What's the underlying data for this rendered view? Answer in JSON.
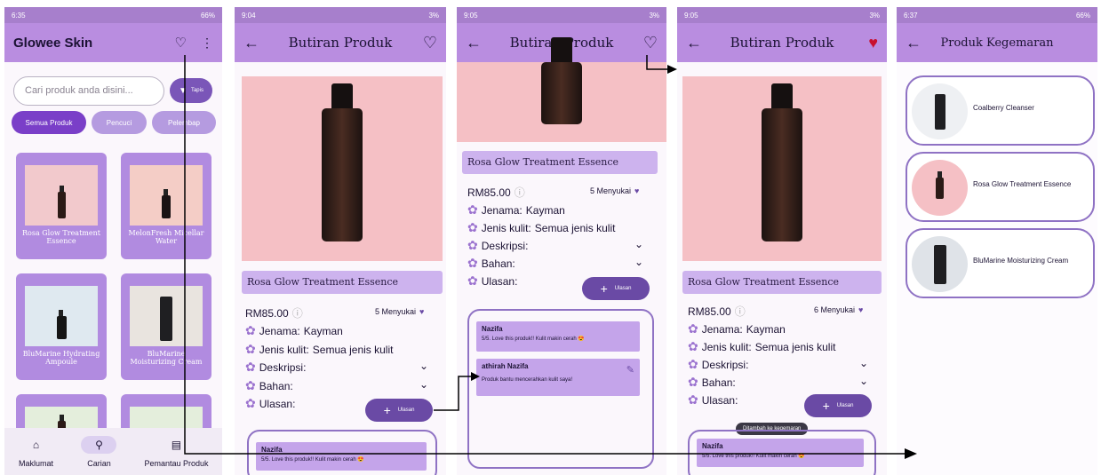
{
  "screen1": {
    "status_time": "6:35",
    "status_right": "66%",
    "brand": "Glowee Skin",
    "search_placeholder": "Cari produk anda disini...",
    "filter_label": "Tapis",
    "chips": [
      "Semua Produk",
      "Pencuci",
      "Pelembap"
    ],
    "products": [
      "Rosa Glow Treatment Essence",
      "MelonFresh Micellar Water",
      "BluMarine Hydrating Ampoule",
      "BluMarine Moisturizing Cream"
    ],
    "nav": [
      "Maklumat",
      "Carian",
      "Pemantau Produk"
    ]
  },
  "detail": {
    "header": "Butiran Produk",
    "product_name": "Rosa Glow Treatment Essence",
    "price": "RM85.00",
    "likes_a": "5 Menyukai",
    "likes_b": "6 Menyukai",
    "brand_label": "Jenama:",
    "brand_value": "Kayman",
    "skin_label": "Jenis kulit:",
    "skin_value": "Semua jenis kulit",
    "desc_label": "Deskripsi:",
    "ingr_label": "Bahan:",
    "review_label": "Ulasan:",
    "review_btn": "Ulasan",
    "reviews": [
      {
        "name": "Nazifa",
        "text": "5/5. Love this produk!! Kulit makin cerah 😍"
      },
      {
        "name": "athirah Nazifa",
        "text": "Produk bantu mencerahkan kulit saya!"
      }
    ],
    "toast": "Ditambah ke kegemaran"
  },
  "status": {
    "t2": "9:04",
    "t3": "9:05",
    "t4": "9:05",
    "t5": "6:37",
    "b2": "3%",
    "b5": "66%"
  },
  "fav": {
    "header": "Produk Kegemaran",
    "items": [
      "Coalberry Cleanser",
      "Rosa Glow Treatment Essence",
      "BluMarine Moisturizing Cream"
    ]
  },
  "colors": {
    "accent": "#b98de0",
    "button": "#6a4aa5",
    "chip_active": "#7a3fc8"
  }
}
